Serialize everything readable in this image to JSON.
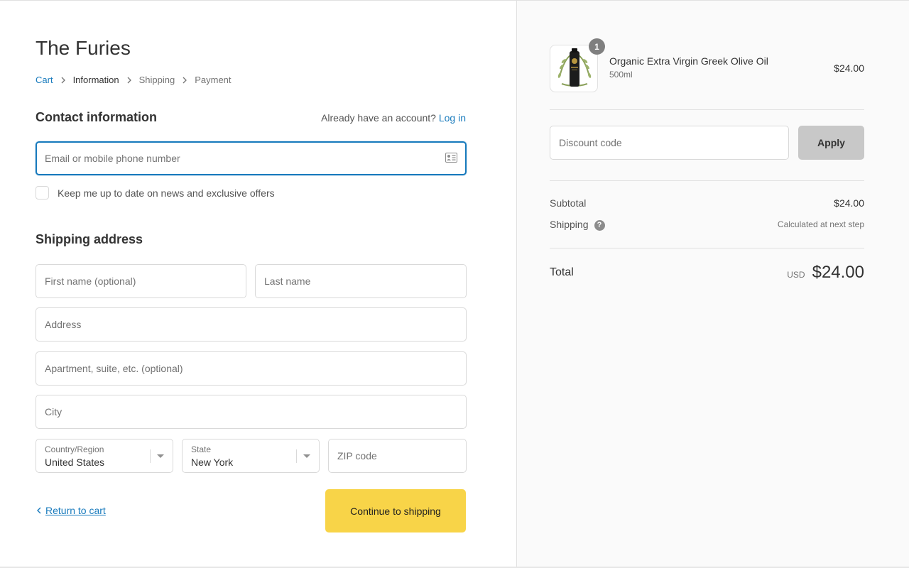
{
  "store": {
    "title": "The Furies"
  },
  "breadcrumb": [
    {
      "label": "Cart",
      "state": "link"
    },
    {
      "label": "Information",
      "state": "current"
    },
    {
      "label": "Shipping",
      "state": "upcoming"
    },
    {
      "label": "Payment",
      "state": "upcoming"
    }
  ],
  "contact": {
    "title": "Contact information",
    "account_prompt": "Already have an account?",
    "login_label": "Log in",
    "email_placeholder": "Email or mobile phone number",
    "email_icon": "contact-card-icon",
    "newsletter_label": "Keep me up to date on news and exclusive offers",
    "newsletter_checked": false
  },
  "shipping": {
    "title": "Shipping address",
    "first_name_placeholder": "First name (optional)",
    "last_name_placeholder": "Last name",
    "address_placeholder": "Address",
    "apartment_placeholder": "Apartment, suite, etc. (optional)",
    "city_placeholder": "City",
    "country_label": "Country/Region",
    "country_value": "United States",
    "state_label": "State",
    "state_value": "New York",
    "zip_placeholder": "ZIP code"
  },
  "actions": {
    "return_label": "Return to cart",
    "continue_label": "Continue to shipping"
  },
  "summary": {
    "product": {
      "name": "Organic Extra Virgin Greek Olive Oil",
      "variant": "500ml",
      "price": "$24.00",
      "quantity": "1"
    },
    "discount_placeholder": "Discount code",
    "apply_label": "Apply",
    "subtotal_label": "Subtotal",
    "subtotal_value": "$24.00",
    "shipping_label": "Shipping",
    "shipping_value": "Calculated at next step",
    "total_label": "Total",
    "currency": "USD",
    "total_value": "$24.00"
  },
  "colors": {
    "accent": "#197bbd",
    "primary_button": "#f8d448",
    "apply_button": "#c8c8c8",
    "sidebar_bg": "#fafafa"
  }
}
